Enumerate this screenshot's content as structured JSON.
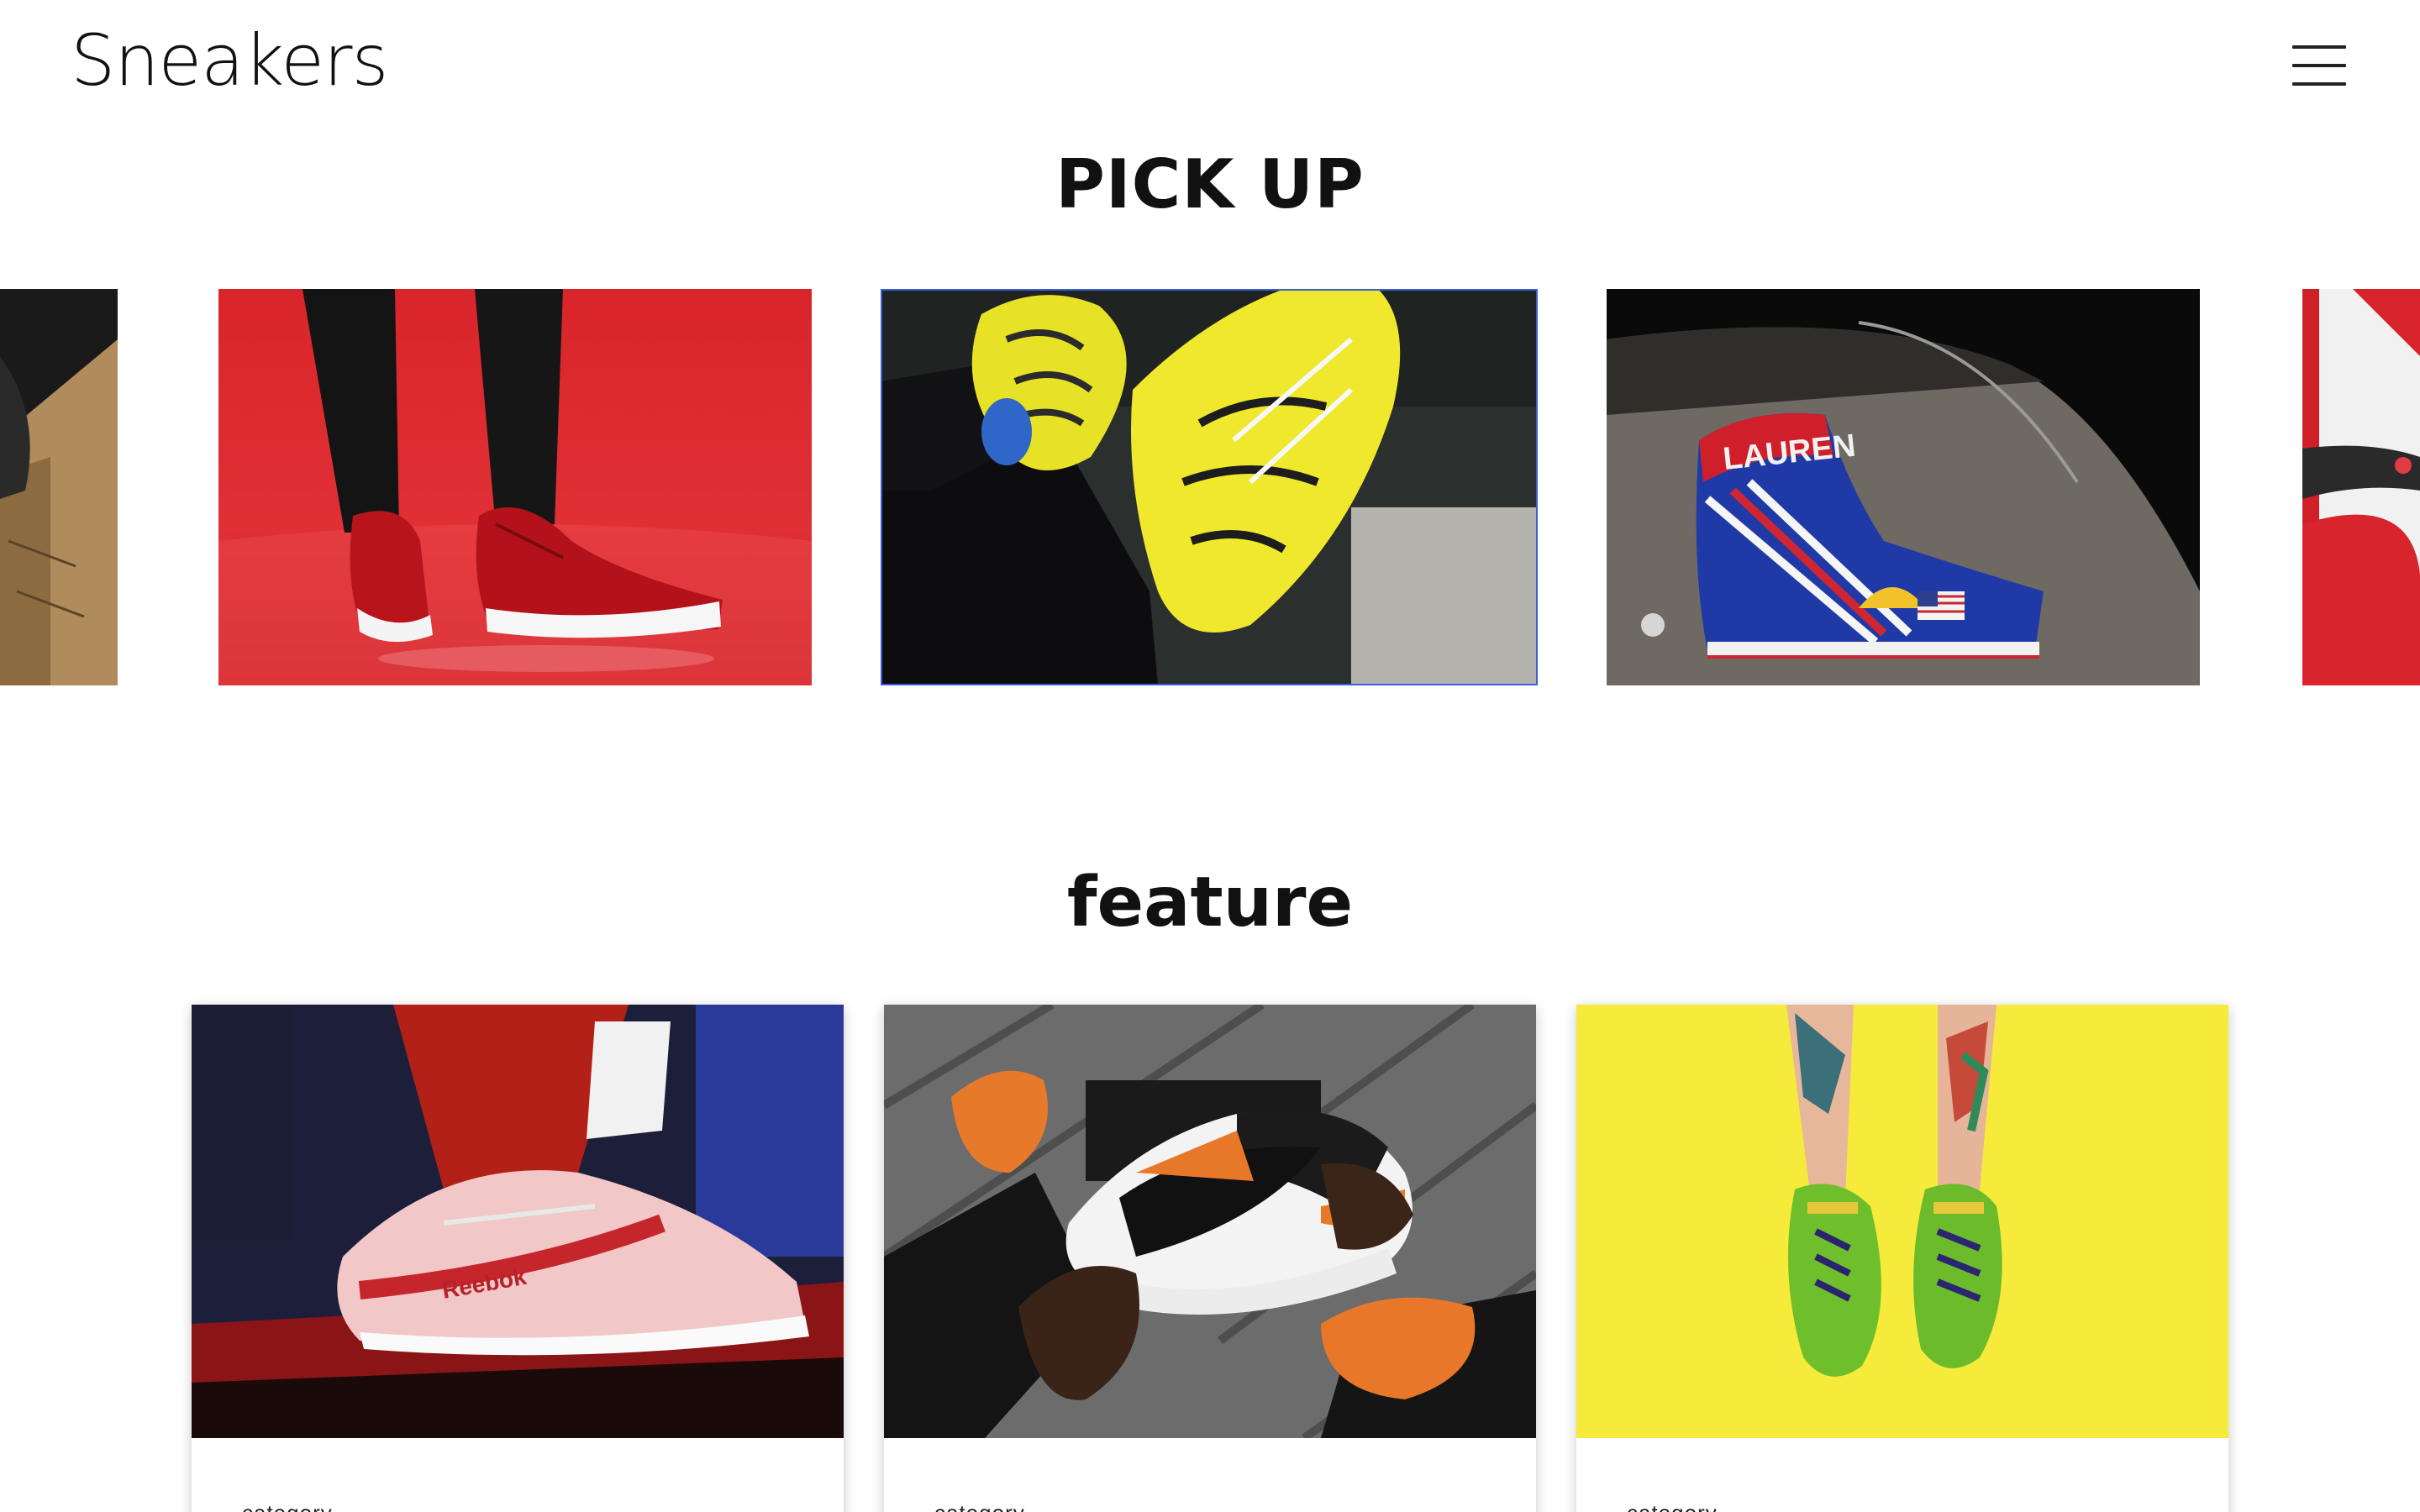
{
  "header": {
    "logo": "Sneakers",
    "menu_icon": "hamburger-menu-icon"
  },
  "pickup": {
    "title": "PICK UP",
    "slides": [
      {
        "name": "partial-left-slide",
        "subject": "sneaker on cardboard box"
      },
      {
        "name": "red-high-tops",
        "subject": "red sneakers on red background"
      },
      {
        "name": "yellow-vapormax",
        "subject": "yellow sneakers crossed feet"
      },
      {
        "name": "lauren-high-top",
        "subject": "flag-painted high-top on car"
      },
      {
        "name": "partial-right-slide",
        "subject": "red sneaker"
      }
    ]
  },
  "feature": {
    "title": "feature",
    "cards": [
      {
        "category": "category",
        "image": "reebok-sneakers-stage"
      },
      {
        "category": "category",
        "image": "orange-black-nike-low"
      },
      {
        "category": "category",
        "image": "green-sneakers-yellow-bg"
      }
    ]
  },
  "colors": {
    "text": "#111111",
    "active_outline": "#3b5fd9",
    "background": "#ffffff"
  }
}
